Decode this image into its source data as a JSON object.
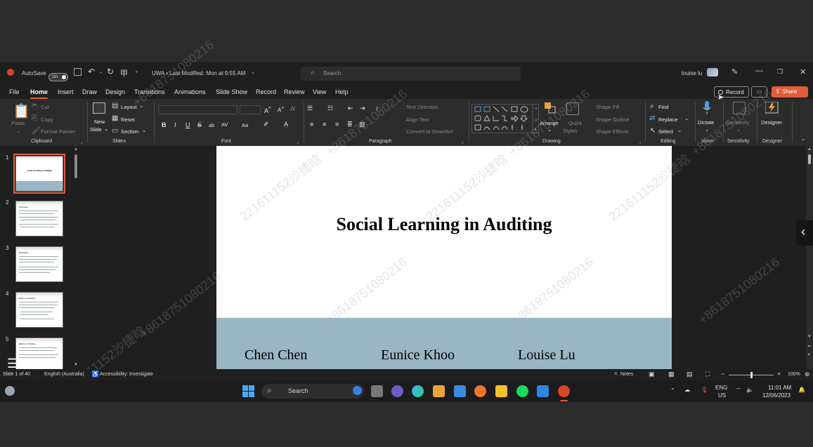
{
  "title_bar": {
    "autosave_label": "AutoSave",
    "autosave_state": "On",
    "doc_title": "UWA • Last Modified: Mon at 9:55 AM",
    "search_placeholder": "Search",
    "user_name": "louise lu"
  },
  "menu": {
    "tabs": [
      "File",
      "Home",
      "Insert",
      "Draw",
      "Design",
      "Transitions",
      "Animations",
      "Slide Show",
      "Record",
      "Review",
      "View",
      "Help"
    ],
    "active": "Home",
    "record_button": "Record",
    "share_button": "Share"
  },
  "ribbon": {
    "clipboard": {
      "paste": "Paste",
      "cut": "Cut",
      "copy": "Copy",
      "format_painter": "Format Painter",
      "group": "Clipboard"
    },
    "slides": {
      "new_slide": "New",
      "new_slide_2": "Slide",
      "layout": "Layout",
      "reset": "Reset",
      "section": "Section",
      "group": "Slides"
    },
    "font": {
      "group": "Font",
      "bold": "B",
      "italic": "I",
      "underline": "U",
      "strike": "S",
      "subscript": "ab",
      "spacing": "AV",
      "case": "Aa"
    },
    "paragraph": {
      "text_direction": "Text Direction",
      "align_text": "Align Text",
      "convert": "Convert to SmartArt",
      "group": "Paragraph"
    },
    "drawing": {
      "arrange": "Arrange",
      "quick_styles": "Quick",
      "quick_styles_2": "Styles",
      "shape_fill": "Shape Fill",
      "shape_outline": "Shape Outline",
      "shape_effects": "Shape Effects",
      "group": "Drawing"
    },
    "editing": {
      "find": "Find",
      "replace": "Replace",
      "select": "Select",
      "group": "Editing"
    },
    "voice": {
      "dictate": "Dictate",
      "group": "Voice"
    },
    "sensitivity": {
      "label": "Sensitivity",
      "group": "Sensitivity"
    },
    "designer": {
      "label": "Designer",
      "group": "Designer"
    }
  },
  "thumbnails": [
    {
      "num": "1",
      "title": "Social Learning in Auditing"
    },
    {
      "num": "2",
      "title": "Overview"
    },
    {
      "num": "3",
      "title": "Motivation"
    },
    {
      "num": "4",
      "title": "Effect on Practice"
    },
    {
      "num": "5",
      "title": "Effect on Practice"
    }
  ],
  "slide": {
    "title": "Social Learning in Auditing",
    "presenters": [
      "Chen Chen",
      "Eunice Khoo",
      "Louise Lu"
    ]
  },
  "watermark": "+8618751080216",
  "watermark_2": "221611152沙捷晗",
  "status_bar": {
    "slide_counter": "Slide 1 of 40",
    "language": "English (Australia)",
    "accessibility": "Accessibility: Investigate",
    "notes": "Notes",
    "zoom": "100%"
  },
  "taskbar": {
    "search": "Search",
    "lang_top": "ENG",
    "lang_bottom": "US",
    "time": "11:01 AM",
    "date": "12/06/2023"
  },
  "colors": {
    "accent": "#e05d3a",
    "slide_band": "#9ab5c3",
    "ribbon_bg": "#2c2c2c",
    "app_bg": "#1f1f1f"
  }
}
